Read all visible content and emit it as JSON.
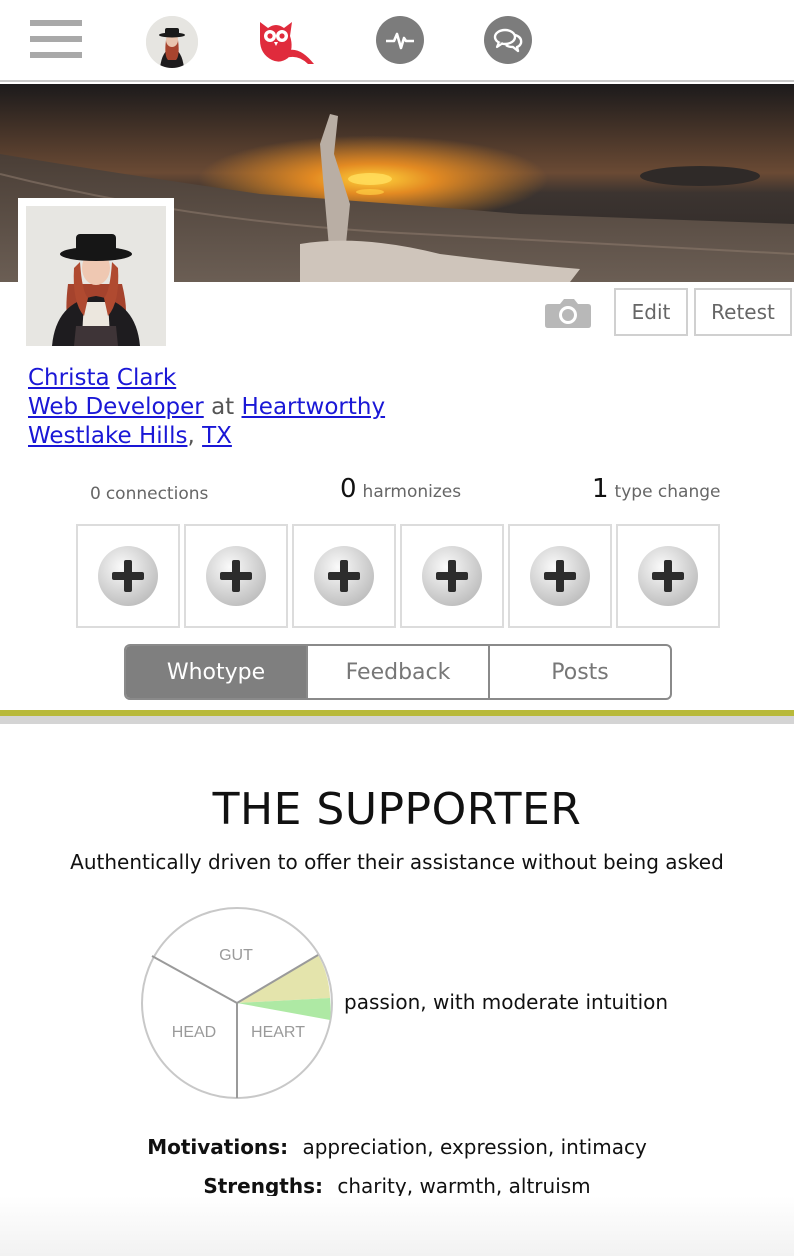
{
  "nav": {
    "menu_icon": "hamburger-icon",
    "profile_icon": "avatar",
    "brand_icon": "owl-logo-icon",
    "activity_icon": "pulse-icon",
    "chat_icon": "chat-bubbles-icon",
    "brand_color": "#e02b3c"
  },
  "profile": {
    "first_name": "Christa",
    "last_name": "Clark",
    "job_title": "Web Developer",
    "at_word": "at",
    "company": "Heartworthy",
    "city": "Westlake Hills",
    "comma": ",",
    "state": "TX"
  },
  "actions": {
    "camera_icon": "camera-icon",
    "edit_label": "Edit",
    "retest_label": "Retest"
  },
  "stats": {
    "connections_count": "0",
    "connections_label": "connections",
    "harmonizes_count": "0",
    "harmonizes_label": "harmonizes",
    "type_change_count": "1",
    "type_change_label": "type change"
  },
  "slots": [
    "add-icon",
    "add-icon",
    "add-icon",
    "add-icon",
    "add-icon",
    "add-icon"
  ],
  "tabs": [
    {
      "label": "Whotype",
      "active": true
    },
    {
      "label": "Feedback",
      "active": false
    },
    {
      "label": "Posts",
      "active": false
    }
  ],
  "whotype": {
    "title": "THE SUPPORTER",
    "subtitle": "Authentically driven to offer their assistance without being asked",
    "pie_labels": {
      "gut": "GUT",
      "head": "HEAD",
      "heart": "HEART"
    },
    "pie_description": "passion, with moderate intuition",
    "highlight_colors": [
      "#e3e3a8",
      "#aee9a4"
    ],
    "motivations_label": "Motivations:",
    "motivations": "appreciation, expression, intimacy",
    "strengths_label": "Strengths:",
    "strengths": "charity, warmth, altruism"
  },
  "colors": {
    "accent_olive": "#b8b93a",
    "link": "#1a17d6",
    "tab_active": "#7f7f7f"
  }
}
